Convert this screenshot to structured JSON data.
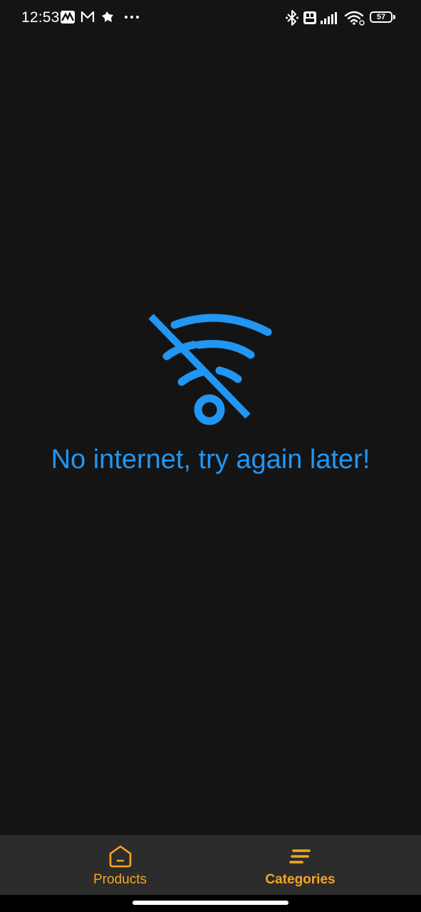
{
  "status_bar": {
    "time": "12:53",
    "battery_level": "57",
    "left_icons": [
      "maps-activity-icon",
      "gmail-icon",
      "bird-icon",
      "more-dots-icon"
    ],
    "right_icons": [
      "bluetooth-icon",
      "volte-icon",
      "signal-icon",
      "wifi-icon",
      "battery-icon"
    ]
  },
  "main": {
    "icon": "wifi-off-icon",
    "message": "No internet, try again later!"
  },
  "bottom_nav": {
    "items": [
      {
        "label": "Products",
        "icon": "home-icon",
        "active": false
      },
      {
        "label": "Categories",
        "icon": "categories-icon",
        "active": true
      }
    ]
  },
  "colors": {
    "background": "#141414",
    "accent": "#2196f3",
    "nav_accent": "#f5a623",
    "nav_background": "#2c2c2c"
  }
}
